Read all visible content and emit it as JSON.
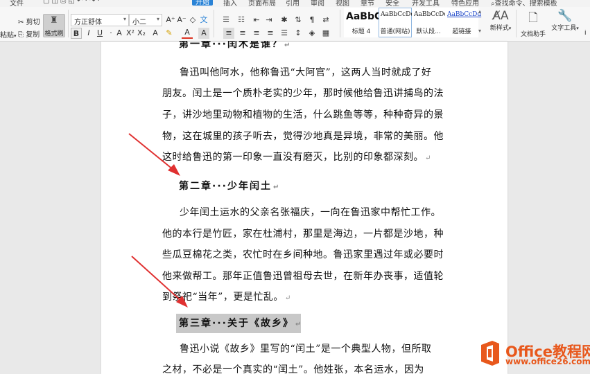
{
  "menu": {
    "items": [
      "文件",
      "开始",
      "插入",
      "页面布局",
      "引用",
      "审阅",
      "视图",
      "章节",
      "安全",
      "开发工具",
      "特色应用",
      "查找命令、搜索模板"
    ],
    "active_index": 1
  },
  "ribbon": {
    "paste_label": "粘贴",
    "cut_label": "剪切",
    "copy_label": "复制",
    "format_brush_label": "格式刷",
    "font_name": "方正舒体",
    "font_size": "小二",
    "styles": [
      {
        "sample": "AaBbC",
        "name": "标题 4"
      },
      {
        "sample": "AaBbCcDd",
        "name": "普通(网站)"
      },
      {
        "sample": "AaBbCcDd",
        "name": "默认段..."
      },
      {
        "sample": "AaBbCcDd",
        "name": "超链接"
      }
    ],
    "new_style_label": "新样式",
    "doc_assistant_label": "文档助手",
    "text_tools_label": "文字工具"
  },
  "document": {
    "chapter1_heading": "第一章···闰木是谁？",
    "para1": [
      "鲁迅叫他阿水，他称鲁迅“大阿官”，这两人当时就成了好",
      "朋友。闰土是一个质朴老实的少年，那时候他给鲁迅讲捕鸟的法",
      "子，讲沙地里动物和植物的生活，什么跳鱼等等，种种奇异的景",
      "物，这在城里的孩子听去，觉得沙地真是异境，非常的美丽。他",
      "这时给鲁迅的第一印象一直没有磨灭，比别的印象都深刻。"
    ],
    "chapter2_heading": "第二章···少年闰土",
    "para2": [
      "少年闰土运水的父亲名张福庆，一向在鲁迅家中帮忙工作。",
      "他的本行是竹匠，家在杜浦村，那里是海边，一片都是沙地，种",
      "些瓜豆棉花之类，农忙时在乡间种地。鲁迅家里遇过年或必要时",
      "他来做帮工。那年正值鲁迅曾祖母去世，在新年办丧事，适值轮",
      "到祭祀“当年”，更是忙乱。"
    ],
    "chapter3_heading": "第三章···关于《故乡》",
    "para3": [
      "鲁迅小说《故乡》里写的“闰土”是一个典型人物，但所取",
      "之材，不必是一个真实的“闰土”。他姓张，本名运水，因为"
    ],
    "paragraph_mark": "↵"
  },
  "watermark": {
    "title": "Office教程网",
    "url": "www.office26.com"
  },
  "colors": {
    "arrow": "#e03030",
    "watermark": "#e8581c",
    "accent": "#2a83d6"
  }
}
